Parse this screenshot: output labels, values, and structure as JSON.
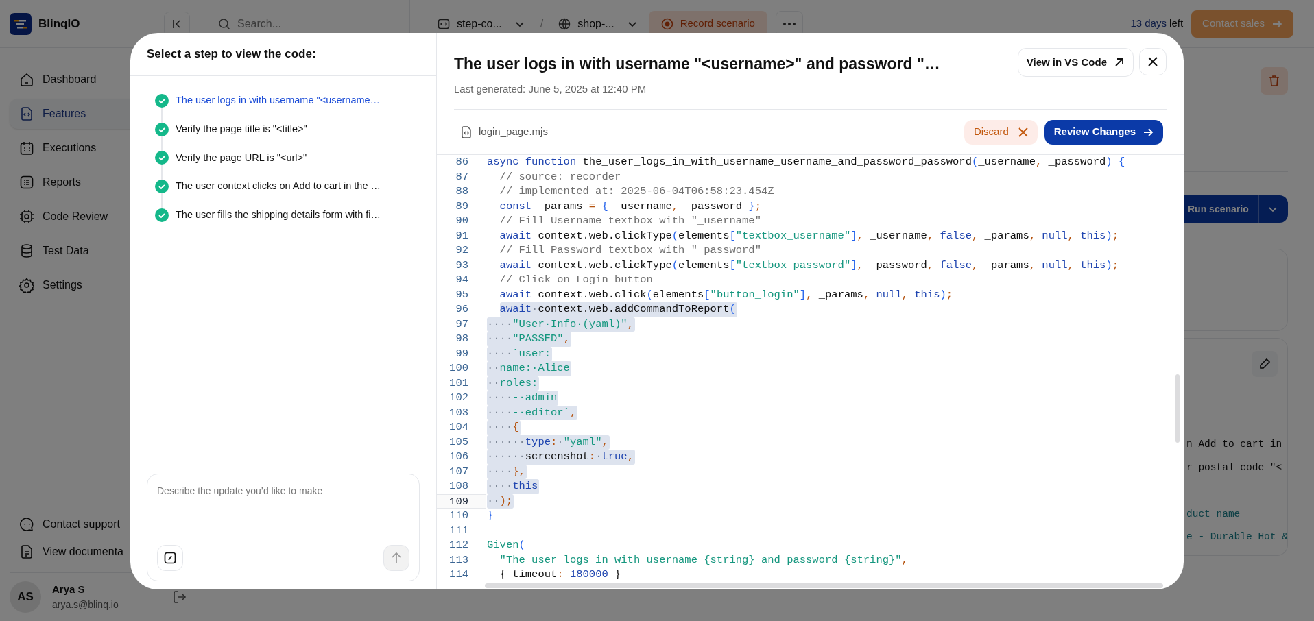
{
  "app": {
    "logo": {
      "text": "BlinqIO"
    },
    "search": {
      "placeholder": "Search..."
    },
    "breadcrumbs": [
      {
        "kind": "project",
        "text": "step-co..."
      },
      {
        "kind": "environment",
        "text": "shop-..."
      }
    ],
    "breadcrumb_separator": "/",
    "record_button": "Record scenario",
    "trial": {
      "count": "13 days",
      "suffix": "left"
    },
    "contact_sales_button": "Contact sales",
    "nav": [
      {
        "label": "Dashboard",
        "selected": false
      },
      {
        "label": "Features",
        "selected": true
      },
      {
        "label": "Executions",
        "selected": false
      },
      {
        "label": "Reports",
        "selected": false
      },
      {
        "label": "Code Review",
        "selected": false
      },
      {
        "label": "Test Data",
        "selected": false
      },
      {
        "label": "Settings",
        "selected": false
      }
    ],
    "footer_links": [
      "Contact support",
      "View documenta"
    ],
    "user": {
      "initials": "AS",
      "name": "Arya S",
      "email": "arya.s@blinq.io"
    },
    "run_button": "Run scenario",
    "code_fragments": [
      {
        "kind": "plain",
        "text": "n Add to cart in"
      },
      {
        "kind": "plain",
        "text": "r postal code \"<"
      },
      {
        "kind": "string",
        "text": "duct_name"
      },
      {
        "kind": "string",
        "text": "e - Durable Hot &"
      }
    ]
  },
  "modal": {
    "steps_heading": "Select a step to view the code:",
    "steps": [
      {
        "label": "The user logs in with username \"<username…",
        "selected": true
      },
      {
        "label": "Verify the page title is \"<title>\"",
        "selected": false
      },
      {
        "label": "Verify the page URL is \"<url>\"",
        "selected": false
      },
      {
        "label": "The user context clicks on Add to cart in the …",
        "selected": false
      },
      {
        "label": "The user fills the shipping details form with fi…",
        "selected": false
      }
    ],
    "prompt": {
      "placeholder": "Describe the update you’d like to make"
    },
    "send_button": {
      "disabled": true
    },
    "title": "The user logs in with username \"<username>\" and password \"…",
    "subtitle": "Last generated: June 5, 2025 at 12:40 PM",
    "vscode_button": "View in VS Code",
    "file_name": "login_page.mjs",
    "discard_button": "Discard",
    "review_button": "Review Changes",
    "code_lines": [
      {
        "number": "86",
        "indented": false,
        "selected": false,
        "current": false,
        "tokens": [
          {
            "kind": "keyword",
            "text": "async function"
          },
          {
            "kind": "plain",
            "text": " the_user_logs_in_with_username_username_and_password_password"
          },
          {
            "kind": "bracket",
            "text": "("
          },
          {
            "kind": "plain",
            "text": "_username"
          },
          {
            "kind": "punct",
            "text": ", "
          },
          {
            "kind": "plain",
            "text": "_password"
          },
          {
            "kind": "bracket",
            "text": ") {"
          }
        ]
      },
      {
        "number": "87",
        "indented": true,
        "selected": false,
        "current": false,
        "tokens": [
          {
            "kind": "comment",
            "text": "// source: recorder"
          }
        ]
      },
      {
        "number": "88",
        "indented": true,
        "selected": false,
        "current": false,
        "tokens": [
          {
            "kind": "comment",
            "text": "// implemented_at: 2025-06-04T06:58:23.454Z"
          }
        ]
      },
      {
        "number": "89",
        "indented": true,
        "selected": false,
        "current": false,
        "tokens": [
          {
            "kind": "keyword",
            "text": "const"
          },
          {
            "kind": "plain",
            "text": " _params "
          },
          {
            "kind": "punct",
            "text": "= "
          },
          {
            "kind": "bracket",
            "text": "{ "
          },
          {
            "kind": "plain",
            "text": "_username"
          },
          {
            "kind": "punct",
            "text": ", "
          },
          {
            "kind": "plain",
            "text": "_password "
          },
          {
            "kind": "bracket",
            "text": "}"
          },
          {
            "kind": "punct",
            "text": ";"
          }
        ]
      },
      {
        "number": "90",
        "indented": true,
        "selected": false,
        "current": false,
        "tokens": [
          {
            "kind": "comment",
            "text": "// Fill Username textbox with \"_username\""
          }
        ]
      },
      {
        "number": "91",
        "indented": true,
        "selected": false,
        "current": false,
        "tokens": [
          {
            "kind": "keyword",
            "text": "await"
          },
          {
            "kind": "plain",
            "text": " context.web.clickType"
          },
          {
            "kind": "bracket",
            "text": "("
          },
          {
            "kind": "plain",
            "text": "elements"
          },
          {
            "kind": "bracket",
            "text": "["
          },
          {
            "kind": "string",
            "text": "\"textbox_username\""
          },
          {
            "kind": "bracket",
            "text": "]"
          },
          {
            "kind": "punct",
            "text": ", "
          },
          {
            "kind": "plain",
            "text": "_username"
          },
          {
            "kind": "punct",
            "text": ", "
          },
          {
            "kind": "keyword",
            "text": "false"
          },
          {
            "kind": "punct",
            "text": ", "
          },
          {
            "kind": "plain",
            "text": "_params"
          },
          {
            "kind": "punct",
            "text": ", "
          },
          {
            "kind": "keyword",
            "text": "null"
          },
          {
            "kind": "punct",
            "text": ", "
          },
          {
            "kind": "keyword",
            "text": "this"
          },
          {
            "kind": "bracket",
            "text": ")"
          },
          {
            "kind": "punct",
            "text": ";"
          }
        ]
      },
      {
        "number": "92",
        "indented": true,
        "selected": false,
        "current": false,
        "tokens": [
          {
            "kind": "comment",
            "text": "// Fill Password textbox with \"_password\""
          }
        ]
      },
      {
        "number": "93",
        "indented": true,
        "selected": false,
        "current": false,
        "tokens": [
          {
            "kind": "keyword",
            "text": "await"
          },
          {
            "kind": "plain",
            "text": " context.web.clickType"
          },
          {
            "kind": "bracket",
            "text": "("
          },
          {
            "kind": "plain",
            "text": "elements"
          },
          {
            "kind": "bracket",
            "text": "["
          },
          {
            "kind": "string",
            "text": "\"textbox_password\""
          },
          {
            "kind": "bracket",
            "text": "]"
          },
          {
            "kind": "punct",
            "text": ", "
          },
          {
            "kind": "plain",
            "text": "_password"
          },
          {
            "kind": "punct",
            "text": ", "
          },
          {
            "kind": "keyword",
            "text": "false"
          },
          {
            "kind": "punct",
            "text": ", "
          },
          {
            "kind": "plain",
            "text": "_params"
          },
          {
            "kind": "punct",
            "text": ", "
          },
          {
            "kind": "keyword",
            "text": "null"
          },
          {
            "kind": "punct",
            "text": ", "
          },
          {
            "kind": "keyword",
            "text": "this"
          },
          {
            "kind": "bracket",
            "text": ")"
          },
          {
            "kind": "punct",
            "text": ";"
          }
        ]
      },
      {
        "number": "94",
        "indented": true,
        "selected": false,
        "current": false,
        "tokens": [
          {
            "kind": "comment",
            "text": "// Click on Login button"
          }
        ]
      },
      {
        "number": "95",
        "indented": true,
        "selected": false,
        "current": false,
        "tokens": [
          {
            "kind": "keyword",
            "text": "await"
          },
          {
            "kind": "plain",
            "text": " context.web.click"
          },
          {
            "kind": "bracket",
            "text": "("
          },
          {
            "kind": "plain",
            "text": "elements"
          },
          {
            "kind": "bracket",
            "text": "["
          },
          {
            "kind": "string",
            "text": "\"button_login\""
          },
          {
            "kind": "bracket",
            "text": "]"
          },
          {
            "kind": "punct",
            "text": ", "
          },
          {
            "kind": "plain",
            "text": "_params"
          },
          {
            "kind": "punct",
            "text": ", "
          },
          {
            "kind": "keyword",
            "text": "null"
          },
          {
            "kind": "punct",
            "text": ", "
          },
          {
            "kind": "keyword",
            "text": "this"
          },
          {
            "kind": "bracket",
            "text": ")"
          },
          {
            "kind": "punct",
            "text": ";"
          }
        ]
      },
      {
        "number": "96",
        "indented": true,
        "selected": true,
        "current": false,
        "tokens": [
          {
            "kind": "keyword",
            "text": "await"
          },
          {
            "kind": "whitespace",
            "text": "·"
          },
          {
            "kind": "plain",
            "text": "context.web.addCommandToReport"
          },
          {
            "kind": "bracket",
            "text": "("
          }
        ]
      },
      {
        "number": "97",
        "indented": false,
        "selected": true,
        "current": false,
        "tokens": [
          {
            "kind": "whitespace",
            "text": "····"
          },
          {
            "kind": "string",
            "text": "\"User·Info·(yaml)\""
          },
          {
            "kind": "punct",
            "text": ","
          }
        ]
      },
      {
        "number": "98",
        "indented": false,
        "selected": true,
        "current": false,
        "tokens": [
          {
            "kind": "whitespace",
            "text": "····"
          },
          {
            "kind": "string",
            "text": "\"PASSED\""
          },
          {
            "kind": "punct",
            "text": ","
          }
        ]
      },
      {
        "number": "99",
        "indented": false,
        "selected": true,
        "current": false,
        "tokens": [
          {
            "kind": "whitespace",
            "text": "····"
          },
          {
            "kind": "string",
            "text": "`user:"
          }
        ]
      },
      {
        "number": "100",
        "indented": false,
        "selected": true,
        "current": false,
        "tokens": [
          {
            "kind": "whitespace",
            "text": "··"
          },
          {
            "kind": "string",
            "text": "name:·Alice"
          }
        ]
      },
      {
        "number": "101",
        "indented": false,
        "selected": true,
        "current": false,
        "tokens": [
          {
            "kind": "whitespace",
            "text": "··"
          },
          {
            "kind": "string",
            "text": "roles:"
          }
        ]
      },
      {
        "number": "102",
        "indented": false,
        "selected": true,
        "current": false,
        "tokens": [
          {
            "kind": "whitespace",
            "text": "····"
          },
          {
            "kind": "string",
            "text": "-·admin"
          }
        ]
      },
      {
        "number": "103",
        "indented": false,
        "selected": true,
        "current": false,
        "tokens": [
          {
            "kind": "whitespace",
            "text": "····"
          },
          {
            "kind": "string",
            "text": "-·editor`"
          },
          {
            "kind": "punct",
            "text": ","
          }
        ]
      },
      {
        "number": "104",
        "indented": false,
        "selected": true,
        "current": false,
        "tokens": [
          {
            "kind": "whitespace",
            "text": "····"
          },
          {
            "kind": "punct",
            "text": "{"
          }
        ]
      },
      {
        "number": "105",
        "indented": false,
        "selected": true,
        "current": false,
        "tokens": [
          {
            "kind": "whitespace",
            "text": "······"
          },
          {
            "kind": "keyword",
            "text": "type"
          },
          {
            "kind": "punct",
            "text": ":"
          },
          {
            "kind": "whitespace",
            "text": "·"
          },
          {
            "kind": "string",
            "text": "\"yaml\""
          },
          {
            "kind": "punct",
            "text": ","
          }
        ]
      },
      {
        "number": "106",
        "indented": false,
        "selected": true,
        "current": false,
        "tokens": [
          {
            "kind": "whitespace",
            "text": "······"
          },
          {
            "kind": "plain",
            "text": "screenshot"
          },
          {
            "kind": "punct",
            "text": ":"
          },
          {
            "kind": "whitespace",
            "text": "·"
          },
          {
            "kind": "keyword",
            "text": "true"
          },
          {
            "kind": "punct",
            "text": ","
          }
        ]
      },
      {
        "number": "107",
        "indented": false,
        "selected": true,
        "current": false,
        "tokens": [
          {
            "kind": "whitespace",
            "text": "····"
          },
          {
            "kind": "punct",
            "text": "},"
          }
        ]
      },
      {
        "number": "108",
        "indented": false,
        "selected": true,
        "current": false,
        "tokens": [
          {
            "kind": "whitespace",
            "text": "····"
          },
          {
            "kind": "keyword",
            "text": "this"
          }
        ]
      },
      {
        "number": "109",
        "indented": false,
        "selected": true,
        "current": true,
        "tokens": [
          {
            "kind": "whitespace",
            "text": "··"
          },
          {
            "kind": "punct",
            "text": ");"
          }
        ]
      },
      {
        "number": "110",
        "indented": false,
        "selected": false,
        "current": false,
        "tokens": [
          {
            "kind": "bracket",
            "text": "}"
          }
        ]
      },
      {
        "number": "111",
        "selected": false,
        "current": false
      },
      {
        "number": "112",
        "indented": false,
        "selected": false,
        "current": false,
        "tokens": [
          {
            "kind": "string",
            "text": "Given"
          },
          {
            "kind": "bracket",
            "text": "("
          }
        ]
      },
      {
        "number": "113",
        "indented": true,
        "selected": false,
        "current": false,
        "tokens": [
          {
            "kind": "string",
            "text": "\"The user logs in with username {string} and password {string}\""
          },
          {
            "kind": "punct",
            "text": ","
          }
        ]
      },
      {
        "number": "114",
        "indented": true,
        "selected": false,
        "current": false,
        "tokens": [
          {
            "kind": "plain",
            "text": "{ timeout"
          },
          {
            "kind": "punct",
            "text": ": "
          },
          {
            "kind": "keyword",
            "text": "180000"
          },
          {
            "kind": "plain",
            "text": " }"
          }
        ]
      }
    ]
  }
}
